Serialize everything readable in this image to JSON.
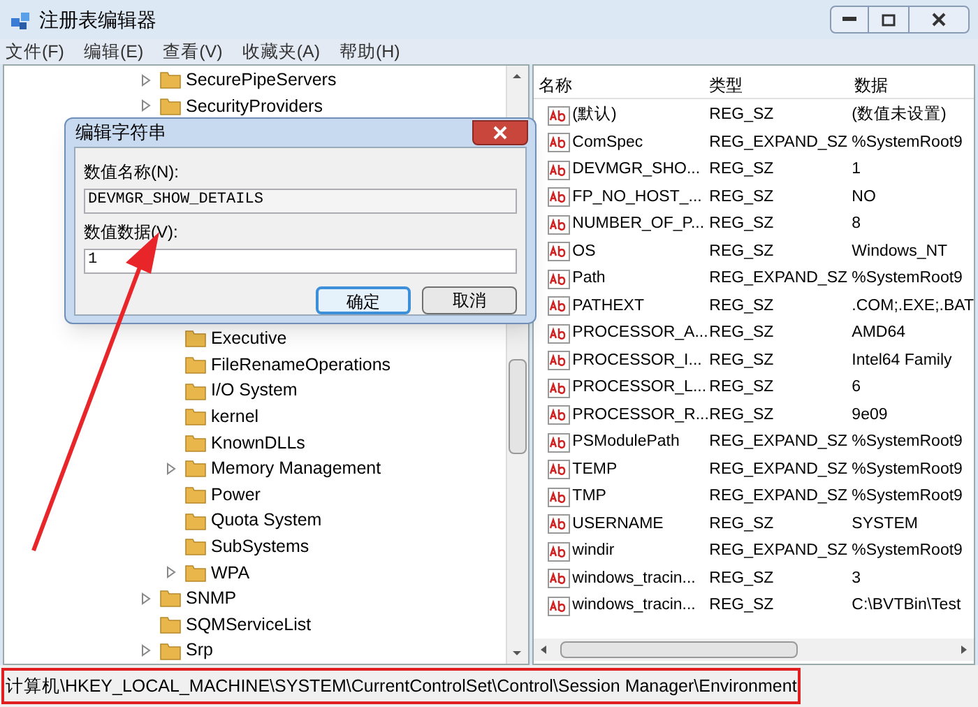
{
  "window": {
    "title": "注册表编辑器"
  },
  "menu": [
    "文件(F)",
    "编辑(E)",
    "查看(V)",
    "收藏夹(A)",
    "帮助(H)"
  ],
  "tree": {
    "items": [
      {
        "label": "SecurePipeServers",
        "has_children": true
      },
      {
        "label": "SecurityProviders",
        "has_children": true
      },
      {
        "children": [
          {
            "label": "Executive",
            "has_children": false
          },
          {
            "label": "FileRenameOperations",
            "has_children": false
          },
          {
            "label": "I/O System",
            "has_children": false
          },
          {
            "label": "kernel",
            "has_children": false
          },
          {
            "label": "KnownDLLs",
            "has_children": false
          },
          {
            "label": "Memory Management",
            "has_children": true
          },
          {
            "label": "Power",
            "has_children": false
          },
          {
            "label": "Quota System",
            "has_children": false
          },
          {
            "label": "SubSystems",
            "has_children": false
          },
          {
            "label": "WPA",
            "has_children": true
          }
        ]
      },
      {
        "label": "SNMP",
        "has_children": true
      },
      {
        "label": "SQMServiceList",
        "has_children": false
      },
      {
        "label": "Srp",
        "has_children": true
      }
    ]
  },
  "values": {
    "columns": [
      "名称",
      "类型",
      "数据"
    ],
    "rows": [
      {
        "name": "(默认)",
        "type": "REG_SZ",
        "data": "(数值未设置)"
      },
      {
        "name": "ComSpec",
        "type": "REG_EXPAND_SZ",
        "data": "%SystemRoot9"
      },
      {
        "name": "DEVMGR_SHO...",
        "type": "REG_SZ",
        "data": "1"
      },
      {
        "name": "FP_NO_HOST_...",
        "type": "REG_SZ",
        "data": "NO"
      },
      {
        "name": "NUMBER_OF_P...",
        "type": "REG_SZ",
        "data": "8"
      },
      {
        "name": "OS",
        "type": "REG_SZ",
        "data": "Windows_NT"
      },
      {
        "name": "Path",
        "type": "REG_EXPAND_SZ",
        "data": "%SystemRoot9"
      },
      {
        "name": "PATHEXT",
        "type": "REG_SZ",
        "data": ".COM;.EXE;.BAT"
      },
      {
        "name": "PROCESSOR_A...",
        "type": "REG_SZ",
        "data": "AMD64"
      },
      {
        "name": "PROCESSOR_I...",
        "type": "REG_SZ",
        "data": "Intel64 Family"
      },
      {
        "name": "PROCESSOR_L...",
        "type": "REG_SZ",
        "data": "6"
      },
      {
        "name": "PROCESSOR_R...",
        "type": "REG_SZ",
        "data": "9e09"
      },
      {
        "name": "PSModulePath",
        "type": "REG_EXPAND_SZ",
        "data": "%SystemRoot9"
      },
      {
        "name": "TEMP",
        "type": "REG_EXPAND_SZ",
        "data": "%SystemRoot9"
      },
      {
        "name": "TMP",
        "type": "REG_EXPAND_SZ",
        "data": "%SystemRoot9"
      },
      {
        "name": "USERNAME",
        "type": "REG_SZ",
        "data": "SYSTEM"
      },
      {
        "name": "windir",
        "type": "REG_EXPAND_SZ",
        "data": "%SystemRoot9"
      },
      {
        "name": "windows_tracin...",
        "type": "REG_SZ",
        "data": "3"
      },
      {
        "name": "windows_tracin...",
        "type": "REG_SZ",
        "data": "C:\\BVTBin\\Test"
      }
    ]
  },
  "dialog": {
    "title": "编辑字符串",
    "name_label": "数值名称(N):",
    "name_value": "DEVMGR_SHOW_DETAILS",
    "data_label": "数值数据(V):",
    "data_value": "1",
    "buttons": [
      {
        "label": "确定",
        "default": true
      },
      {
        "label": "取消",
        "default": false
      }
    ]
  },
  "status_bar": {
    "path": "计算机\\HKEY_LOCAL_MACHINE\\SYSTEM\\CurrentControlSet\\Control\\Session Manager\\Environment"
  }
}
